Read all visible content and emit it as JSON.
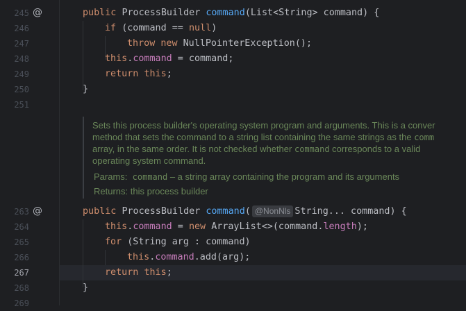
{
  "editor": {
    "lines": {
      "l245": {
        "num": "245",
        "parts": [
          "public ",
          "ProcessBuilder ",
          "command",
          "(List<String> command) {"
        ]
      },
      "l246": {
        "num": "246",
        "parts": [
          "if ",
          "(command == ",
          "null",
          ")"
        ]
      },
      "l247": {
        "num": "247",
        "parts": [
          "throw new ",
          "NullPointerException();"
        ]
      },
      "l248": {
        "num": "248",
        "parts": [
          "this",
          ".",
          "command",
          " = command;"
        ]
      },
      "l249": {
        "num": "249",
        "parts": [
          "return this",
          ";"
        ]
      },
      "l250": {
        "num": "250",
        "parts": [
          "}"
        ]
      },
      "l251": {
        "num": "251"
      },
      "l263": {
        "num": "263",
        "parts": [
          "public ",
          "ProcessBuilder ",
          "command",
          "(",
          "@NonNls",
          "String... command) {"
        ]
      },
      "l264": {
        "num": "264",
        "parts": [
          "this",
          ".",
          "command",
          " = ",
          "new ",
          "ArrayList<>(command.",
          "length",
          ");"
        ]
      },
      "l265": {
        "num": "265",
        "parts": [
          "for ",
          "(String arg : command)"
        ]
      },
      "l266": {
        "num": "266",
        "parts": [
          "this",
          ".",
          "command",
          ".add(arg);"
        ]
      },
      "l267": {
        "num": "267",
        "parts": [
          "return this",
          ";"
        ]
      },
      "l268": {
        "num": "268",
        "parts": [
          "}"
        ]
      },
      "l269": {
        "num": "269"
      }
    },
    "gutter_marker": "@",
    "current_line": "267"
  },
  "doc": {
    "line1": "Sets this process builder's operating system program and arguments. This is a conver",
    "line2_a": "method that sets the command to a string list containing the same strings as the ",
    "line2_b": "comm",
    "line3_a": "array, in the same order. It is not checked whether ",
    "line3_b": "command",
    "line3_c": " corresponds to a valid",
    "line4": "operating system command.",
    "params_label": "Params:",
    "params_name": "command",
    "params_desc": " – a string array containing the program and its arguments",
    "returns_label": "Returns:",
    "returns_desc": "this process builder"
  }
}
